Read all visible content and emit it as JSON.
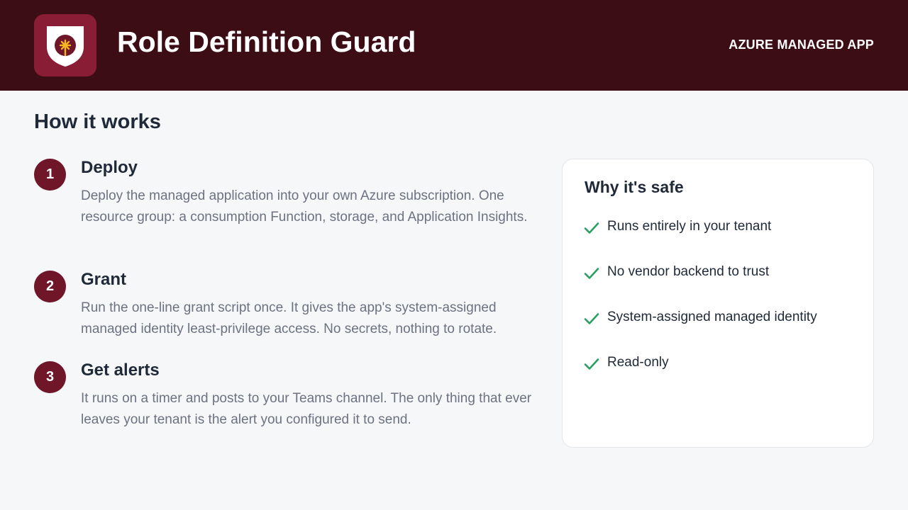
{
  "header": {
    "app_title": "Role Definition Guard",
    "tagline": "AZURE MANAGED APP",
    "logo_icon": "shield-icon"
  },
  "main": {
    "section_title": "How it works",
    "steps": [
      {
        "number": "1",
        "title": "Deploy",
        "description": "Deploy the managed application into your own Azure subscription. One resource group: a consumption Function, storage, and Application Insights."
      },
      {
        "number": "2",
        "title": "Grant",
        "description": "Run the one-line grant script once. It gives the app's system-assigned managed identity least-privilege access. No secrets, nothing to rotate."
      },
      {
        "number": "3",
        "title": "Get alerts",
        "description": "It runs on a timer and posts to your Teams channel. The only thing that ever leaves your tenant is the alert you configured it to send."
      }
    ]
  },
  "safety_card": {
    "title": "Why it's safe",
    "items": [
      {
        "label": "Runs entirely in your tenant",
        "icon": "check-icon"
      },
      {
        "label": "No vendor backend to trust",
        "icon": "check-icon"
      },
      {
        "label": "System-assigned managed identity",
        "icon": "check-icon"
      },
      {
        "label": "Read-only",
        "icon": "check-icon"
      }
    ]
  },
  "colors": {
    "header_bg": "#3d0d16",
    "logo_bg": "#8a1d36",
    "step_badge": "#6f1629",
    "check": "#2a9d62",
    "page_bg": "#f6f7f9"
  }
}
